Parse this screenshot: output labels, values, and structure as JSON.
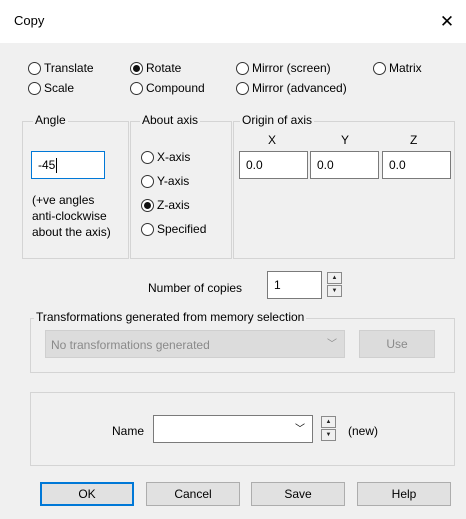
{
  "window": {
    "title": "Copy",
    "close_glyph": "✕"
  },
  "mode": {
    "options": [
      "Translate",
      "Rotate",
      "Mirror (screen)",
      "Matrix",
      "Scale",
      "Compound",
      "Mirror (advanced)"
    ],
    "selected": "Rotate"
  },
  "angle": {
    "group_label": "Angle",
    "value": "-45",
    "hint_lines": [
      "(+ve angles",
      "anti-clockwise",
      "about the axis)"
    ]
  },
  "about_axis": {
    "group_label": "About axis",
    "options": [
      "X-axis",
      "Y-axis",
      "Z-axis",
      "Specified"
    ],
    "selected": "Z-axis"
  },
  "origin": {
    "group_label": "Origin of axis",
    "x_label": "X",
    "y_label": "Y",
    "z_label": "Z",
    "x": "0.0",
    "y": "0.0",
    "z": "0.0"
  },
  "copies": {
    "label": "Number of copies",
    "value": "1"
  },
  "transformations": {
    "group_label": "Transformations generated from memory selection",
    "selected": "No transformations generated",
    "use_label": "Use"
  },
  "name": {
    "label": "Name",
    "value": "",
    "status": "(new)"
  },
  "buttons": {
    "ok": "OK",
    "cancel": "Cancel",
    "save": "Save",
    "help": "Help"
  },
  "colors": {
    "focus_border": "#0078d7",
    "dialog_bg": "#f0f0f0"
  }
}
